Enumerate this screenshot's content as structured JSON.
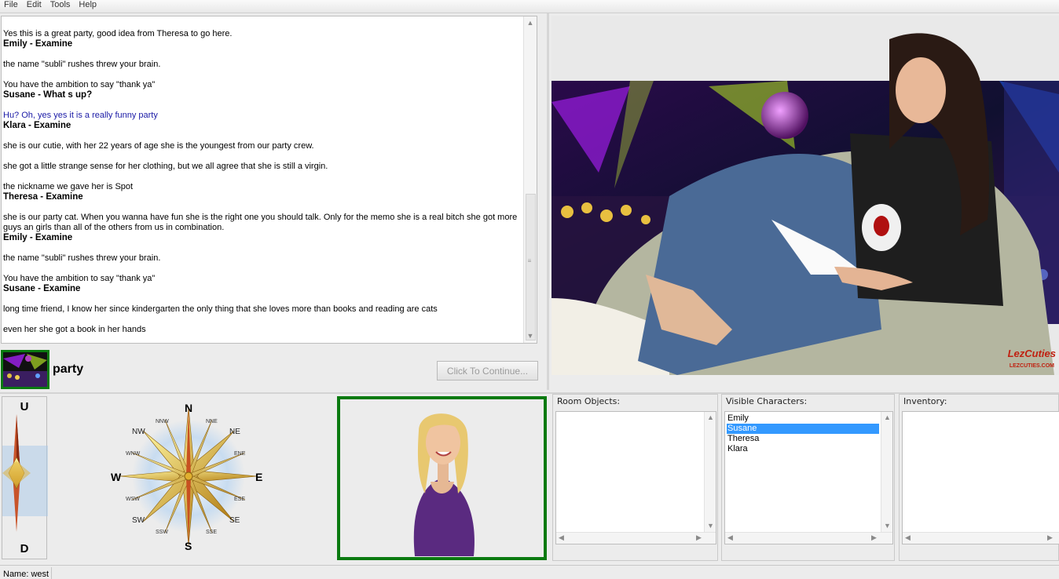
{
  "menu": [
    "File",
    "Edit",
    "Tools",
    "Help"
  ],
  "log": [
    {
      "t": "Yes this is a great party, good idea from Theresa to go here.",
      "s": "n"
    },
    {
      "t": "Emily - Examine",
      "s": "b"
    },
    {
      "t": "",
      "s": "gap"
    },
    {
      "t": "the name \"subli\" rushes threw your brain.",
      "s": "n"
    },
    {
      "t": "",
      "s": "gap"
    },
    {
      "t": "You have the ambition to say \"thank ya\"",
      "s": "n"
    },
    {
      "t": "Susane - What s up?",
      "s": "b"
    },
    {
      "t": "",
      "s": "gap"
    },
    {
      "t": "Hu? Oh, yes yes it is a really funny party",
      "s": "blue"
    },
    {
      "t": "Klara - Examine",
      "s": "b"
    },
    {
      "t": "",
      "s": "gap"
    },
    {
      "t": "she is our cutie, with her 22 years of age she is the youngest from our party crew.",
      "s": "n"
    },
    {
      "t": "",
      "s": "gap"
    },
    {
      "t": "she got a little strange sense for her clothing, but we all agree that she is still a virgin.",
      "s": "n"
    },
    {
      "t": "",
      "s": "gap"
    },
    {
      "t": "the nickname we gave her is Spot",
      "s": "n"
    },
    {
      "t": "Theresa - Examine",
      "s": "b"
    },
    {
      "t": "",
      "s": "gap"
    },
    {
      "t": "she is our party cat. When you wanna have fun she is the right one you should talk. Only for the memo she is a real bitch she got more guys an girls than all of the others from us in combination.",
      "s": "n"
    },
    {
      "t": "Emily - Examine",
      "s": "b"
    },
    {
      "t": "",
      "s": "gap"
    },
    {
      "t": "the name \"subli\" rushes threw your brain.",
      "s": "n"
    },
    {
      "t": "",
      "s": "gap"
    },
    {
      "t": "You have the ambition to say \"thank ya\"",
      "s": "n"
    },
    {
      "t": "Susane - Examine",
      "s": "b"
    },
    {
      "t": "",
      "s": "gap"
    },
    {
      "t": "long time friend, I know her since kindergarten the only thing that she loves more than books and reading are cats",
      "s": "n"
    },
    {
      "t": "",
      "s": "gap"
    },
    {
      "t": "even her she got a book in her hands",
      "s": "n"
    }
  ],
  "location": {
    "name": "party"
  },
  "continue_label": "Click To Continue...",
  "updown": {
    "up": "U",
    "down": "D"
  },
  "compass": {
    "N": "N",
    "S": "S",
    "E": "E",
    "W": "W",
    "NE": "NE",
    "NW": "NW",
    "SE": "SE",
    "SW": "SW",
    "NNE": "NNE",
    "NNW": "NNW",
    "ENE": "ENE",
    "ESE": "ESE",
    "SSE": "SSE",
    "SSW": "SSW",
    "WSW": "WSW",
    "WNW": "WNW"
  },
  "scene_logo": "LezCuties",
  "scene_logo_url": "LEZCUTIES.COM",
  "room_objects": {
    "title": "Room Objects:",
    "items": []
  },
  "visible_characters": {
    "title": "Visible Characters:",
    "items": [
      "Emily",
      "Susane",
      "Theresa",
      "Klara"
    ],
    "selected": "Susane"
  },
  "inventory": {
    "title": "Inventory:",
    "items": []
  },
  "status": {
    "text": "Name: west"
  },
  "colors": {
    "highlight": "#3399ff",
    "frame_green": "#0a7a10",
    "dialog_blue": "#1a1aa6"
  }
}
